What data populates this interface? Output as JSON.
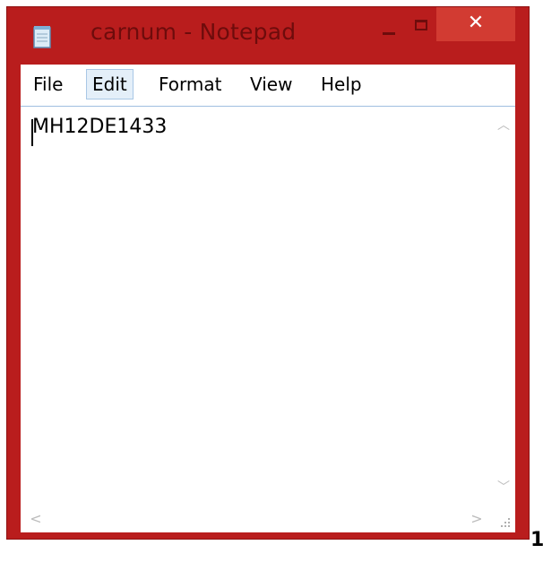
{
  "window": {
    "title": "carnum - Notepad",
    "close_glyph": "✕",
    "colors": {
      "frame": "#b91d1d",
      "title_text": "#6e0c0c",
      "close_button": "#d23b32",
      "menu_highlight": "#e4eff9"
    }
  },
  "menu": {
    "items": [
      {
        "label": "File"
      },
      {
        "label": "Edit",
        "highlighted": true
      },
      {
        "label": "Format"
      },
      {
        "label": "View"
      },
      {
        "label": "Help"
      }
    ]
  },
  "editor": {
    "content": "MH12DE1433",
    "scroll_up_glyph": "︿",
    "scroll_down_glyph": "﹀",
    "scroll_left_glyph": "<",
    "scroll_right_glyph": ">"
  },
  "page_number": "1",
  "icons": [
    "notepad-app-icon",
    "minimize-icon",
    "maximize-icon",
    "close-icon",
    "scroll-up-icon",
    "scroll-down-icon",
    "scroll-left-icon",
    "scroll-right-icon",
    "size-grip-icon"
  ]
}
